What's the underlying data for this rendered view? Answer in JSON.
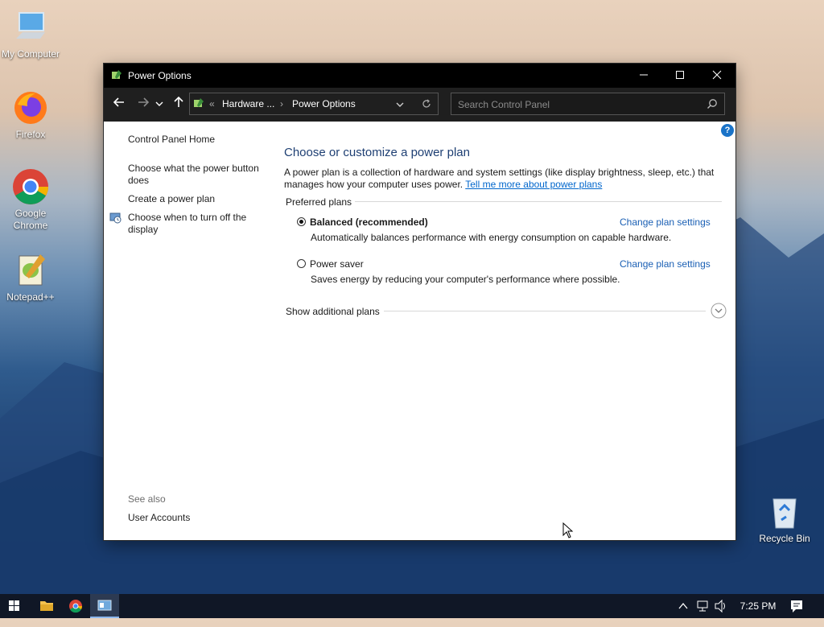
{
  "desktop": {
    "icons": [
      {
        "label": "My Computer",
        "icon": "computer-icon"
      },
      {
        "label": "Firefox",
        "icon": "firefox-icon"
      },
      {
        "label": "Google Chrome",
        "icon": "chrome-icon"
      },
      {
        "label": "Notepad++",
        "icon": "notepadpp-icon"
      },
      {
        "label": "Recycle Bin",
        "icon": "recycle-bin-icon"
      }
    ]
  },
  "window": {
    "title": "Power Options",
    "breadcrumb": {
      "overflow": "«",
      "parent": "Hardware ...",
      "current": "Power Options"
    },
    "search_placeholder": "Search Control Panel"
  },
  "sidebar": {
    "home": "Control Panel Home",
    "links": [
      "Choose what the power button does",
      "Create a power plan",
      "Choose when to turn off the display"
    ],
    "see_also_heading": "See also",
    "see_also_links": [
      "User Accounts"
    ]
  },
  "main": {
    "title": "Choose or customize a power plan",
    "description": "A power plan is a collection of hardware and system settings (like display brightness, sleep, etc.) that manages how your computer uses power.",
    "more_link": "Tell me more about power plans",
    "preferred_heading": "Preferred plans",
    "plans": [
      {
        "name": "Balanced (recommended)",
        "selected": true,
        "description": "Automatically balances performance with energy consumption on capable hardware.",
        "settings_link": "Change plan settings"
      },
      {
        "name": "Power saver",
        "selected": false,
        "description": "Saves energy by reducing your computer's performance where possible.",
        "settings_link": "Change plan settings"
      }
    ],
    "additional_plans": "Show additional plans"
  },
  "taskbar": {
    "clock": "7:25 PM"
  }
}
